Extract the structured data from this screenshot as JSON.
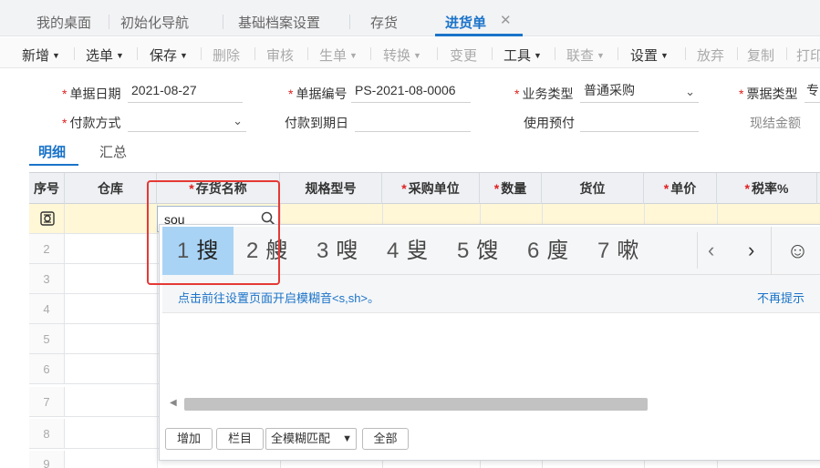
{
  "tabs": [
    {
      "label": "我的桌面"
    },
    {
      "label": "初始化导航"
    },
    {
      "label": "基础档案设置"
    },
    {
      "label": "存货"
    },
    {
      "label": "进货单"
    }
  ],
  "toolbar": [
    {
      "label": "新增",
      "dropdown": true
    },
    {
      "label": "选单",
      "dropdown": true
    },
    {
      "label": "保存",
      "dropdown": true
    },
    {
      "label": "删除",
      "disabled": true
    },
    {
      "label": "审核",
      "disabled": true
    },
    {
      "label": "生单",
      "dropdown": true,
      "disabled": true
    },
    {
      "label": "转换",
      "dropdown": true,
      "disabled": true
    },
    {
      "label": "变更",
      "disabled": true
    },
    {
      "label": "工具",
      "dropdown": true
    },
    {
      "label": "联查",
      "dropdown": true,
      "disabled": true
    },
    {
      "label": "设置",
      "dropdown": true
    },
    {
      "label": "放弃",
      "disabled": true
    },
    {
      "label": "复制",
      "disabled": true
    },
    {
      "label": "打印"
    }
  ],
  "form": {
    "doc_date_label": "单据日期",
    "doc_date_value": "2021-08-27",
    "doc_no_label": "单据编号",
    "doc_no_value": "PS-2021-08-0006",
    "biz_type_label": "业务类型",
    "biz_type_value": "普通采购",
    "invoice_type_label": "票据类型",
    "invoice_type_value": "专",
    "pay_method_label": "付款方式",
    "pay_method_value": "",
    "pay_due_label": "付款到期日",
    "pay_due_value": "",
    "prepay_label": "使用预付",
    "prepay_value": "",
    "cash_amount_label": "现结金额"
  },
  "subtabs": [
    {
      "label": "明细"
    },
    {
      "label": "汇总"
    }
  ],
  "grid": {
    "columns": [
      {
        "label": "序号",
        "required": false
      },
      {
        "label": "仓库",
        "required": false
      },
      {
        "label": "存货名称",
        "required": true
      },
      {
        "label": "规格型号",
        "required": false
      },
      {
        "label": "采购单位",
        "required": true
      },
      {
        "label": "数量",
        "required": true
      },
      {
        "label": "货位",
        "required": false
      },
      {
        "label": "单价",
        "required": true
      },
      {
        "label": "税率%",
        "required": true
      }
    ],
    "row_numbers": [
      "2",
      "3",
      "4",
      "5",
      "6",
      "7",
      "8",
      "9"
    ]
  },
  "search": {
    "value": "sou"
  },
  "ime": {
    "candidates": [
      {
        "num": "1",
        "char": "搜",
        "selected": true
      },
      {
        "num": "2",
        "char": "艘"
      },
      {
        "num": "3",
        "char": "嗖"
      },
      {
        "num": "4",
        "char": "叟"
      },
      {
        "num": "5",
        "char": "馊"
      },
      {
        "num": "6",
        "char": "廋"
      },
      {
        "num": "7",
        "char": "嗽"
      }
    ],
    "prev": "‹",
    "next": "›",
    "emoji": "☺"
  },
  "hint": {
    "text": "点击前往设置页面开启模糊音<s,sh>。",
    "dismiss": "不再提示"
  },
  "popup_footer": {
    "add_label": "增加",
    "columns_label": "栏目",
    "match_mode": "全模糊匹配",
    "all_label": "全部"
  },
  "colors": {
    "accent": "#1a73c9",
    "required": "#e02020",
    "active_row": "#fff7d6",
    "candidate_selected": "#a9d3f5",
    "annotation_box": "#e53935"
  }
}
